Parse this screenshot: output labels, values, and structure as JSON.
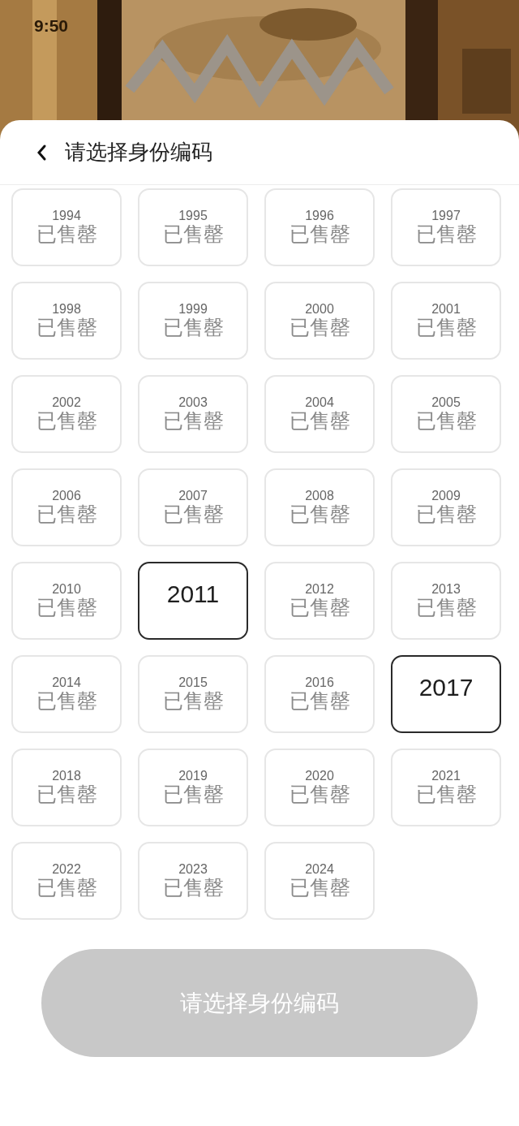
{
  "status_bar": {
    "time": "9:50"
  },
  "header": {
    "title": "请选择身份编码"
  },
  "codes": [
    {
      "year": "1994",
      "kind": "sold_out",
      "status": "已售罄"
    },
    {
      "year": "1995",
      "kind": "sold_out",
      "status": "已售罄"
    },
    {
      "year": "1996",
      "kind": "sold_out",
      "status": "已售罄"
    },
    {
      "year": "1997",
      "kind": "sold_out",
      "status": "已售罄"
    },
    {
      "year": "1998",
      "kind": "sold_out",
      "status": "已售罄"
    },
    {
      "year": "1999",
      "kind": "sold_out",
      "status": "已售罄"
    },
    {
      "year": "2000",
      "kind": "sold_out",
      "status": "已售罄"
    },
    {
      "year": "2001",
      "kind": "sold_out",
      "status": "已售罄"
    },
    {
      "year": "2002",
      "kind": "sold_out",
      "status": "已售罄"
    },
    {
      "year": "2003",
      "kind": "sold_out",
      "status": "已售罄"
    },
    {
      "year": "2004",
      "kind": "sold_out",
      "status": "已售罄"
    },
    {
      "year": "2005",
      "kind": "sold_out",
      "status": "已售罄"
    },
    {
      "year": "2006",
      "kind": "sold_out",
      "status": "已售罄"
    },
    {
      "year": "2007",
      "kind": "sold_out",
      "status": "已售罄"
    },
    {
      "year": "2008",
      "kind": "sold_out",
      "status": "已售罄"
    },
    {
      "year": "2009",
      "kind": "sold_out",
      "status": "已售罄"
    },
    {
      "year": "2010",
      "kind": "sold_out",
      "status": "已售罄"
    },
    {
      "year": "2011",
      "kind": "available"
    },
    {
      "year": "2012",
      "kind": "sold_out",
      "status": "已售罄"
    },
    {
      "year": "2013",
      "kind": "sold_out",
      "status": "已售罄"
    },
    {
      "year": "2014",
      "kind": "sold_out",
      "status": "已售罄"
    },
    {
      "year": "2015",
      "kind": "sold_out",
      "status": "已售罄"
    },
    {
      "year": "2016",
      "kind": "sold_out",
      "status": "已售罄"
    },
    {
      "year": "2017",
      "kind": "available"
    },
    {
      "year": "2018",
      "kind": "sold_out",
      "status": "已售罄"
    },
    {
      "year": "2019",
      "kind": "sold_out",
      "status": "已售罄"
    },
    {
      "year": "2020",
      "kind": "sold_out",
      "status": "已售罄"
    },
    {
      "year": "2021",
      "kind": "sold_out",
      "status": "已售罄"
    },
    {
      "year": "2022",
      "kind": "sold_out",
      "status": "已售罄"
    },
    {
      "year": "2023",
      "kind": "sold_out",
      "status": "已售罄"
    },
    {
      "year": "2024",
      "kind": "sold_out",
      "status": "已售罄"
    }
  ],
  "confirm_button": {
    "label": "请选择身份编码",
    "disabled": true
  }
}
